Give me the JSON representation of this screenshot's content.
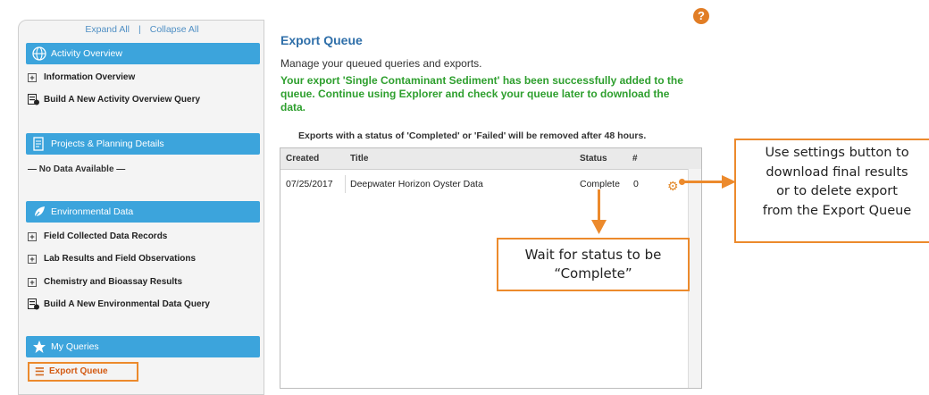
{
  "sidebar": {
    "expand_all": "Expand All",
    "separator": "|",
    "collapse_all": "Collapse All",
    "sections": [
      {
        "title": "Activity Overview",
        "icon": "globe-icon",
        "items": [
          {
            "label": "Information Overview",
            "icon": "plus-box-icon"
          },
          {
            "label": "Build A New Activity Overview Query",
            "icon": "query-builder-icon"
          }
        ]
      },
      {
        "title": "Projects & Planning Details",
        "icon": "document-icon",
        "empty_text": "— No Data Available —"
      },
      {
        "title": "Environmental Data",
        "icon": "leaf-icon",
        "items": [
          {
            "label": "Field Collected Data Records",
            "icon": "plus-box-icon"
          },
          {
            "label": "Lab Results and Field Observations",
            "icon": "plus-box-icon"
          },
          {
            "label": "Chemistry and Bioassay Results",
            "icon": "plus-box-icon"
          },
          {
            "label": "Build A New Environmental Data Query",
            "icon": "query-builder-icon"
          }
        ]
      },
      {
        "title": "My Queries",
        "icon": "star-icon",
        "items": [
          {
            "label": "Export Queue",
            "icon": "list-icon",
            "highlighted": true
          }
        ]
      }
    ]
  },
  "main": {
    "title": "Export Queue",
    "subtitle": "Manage your queued queries and exports.",
    "success_message": "Your export 'Single Contaminant Sediment' has been successfully added to the queue. Continue using Explorer and check your queue later to download the data.",
    "notice": "Exports with a status of 'Completed' or 'Failed' will be removed after 48 hours.",
    "table": {
      "columns": [
        "Created",
        "Title",
        "Status",
        "#"
      ],
      "rows": [
        {
          "created": "07/25/2017",
          "title": "Deepwater Horizon Oyster Data",
          "status": "Complete",
          "count": "0",
          "action_icon": "gear-icon"
        }
      ]
    },
    "help_icon": "?"
  },
  "callouts": {
    "settings": "Use settings button to download final results or to delete export from the Export Queue",
    "settings_lines": [
      "Use settings button to",
      "download final results",
      "or to delete export",
      "from the Export Queue"
    ],
    "status_lines": [
      "Wait for status to be",
      "“Complete”"
    ]
  },
  "colors": {
    "accent_blue": "#3ca4dc",
    "title_blue": "#2f6fa9",
    "success_green": "#2e9f2e",
    "callout_orange": "#ec8a2c"
  }
}
